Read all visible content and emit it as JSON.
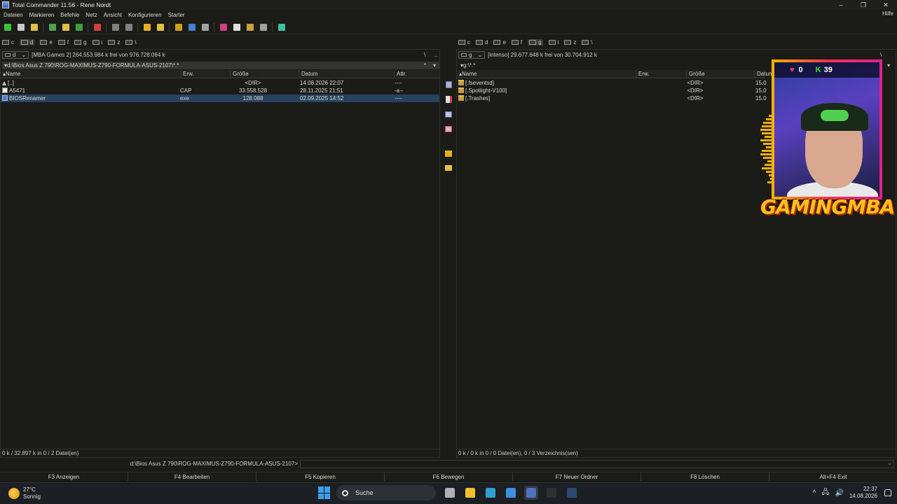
{
  "window": {
    "title": "Total Commander 11.56 - Rene Nordt",
    "controls": [
      "–",
      "❐",
      "✕"
    ]
  },
  "menu": {
    "items": [
      "Dateien",
      "Markieren",
      "Befehle",
      "Netz",
      "Ansicht",
      "Konfigurieren",
      "Starter"
    ],
    "help": "Hilfe"
  },
  "toolbar": {
    "buttons": [
      {
        "icon": "refresh-icon",
        "color": "#3cc03c"
      },
      {
        "icon": "brief-view-icon",
        "color": "#c8c8c8"
      },
      {
        "icon": "detailed-view-icon",
        "color": "#e0c040"
      },
      {
        "icon": "thumbnails-icon",
        "color": "#50a050"
      },
      {
        "icon": "tree-view-icon",
        "color": "#e0c040"
      },
      {
        "icon": "invert-selection-icon",
        "color": "#40a040"
      },
      {
        "icon": "compare-icon",
        "color": "#d04040"
      },
      {
        "icon": "back-icon",
        "color": "#808080"
      },
      {
        "icon": "forward-icon",
        "color": "#808080"
      },
      {
        "icon": "pack-icon",
        "color": "#e0b020"
      },
      {
        "icon": "unpack-icon",
        "color": "#e0c040"
      },
      {
        "icon": "find-icon",
        "color": "#c8a020"
      },
      {
        "icon": "multi-rename-icon",
        "color": "#4080d0"
      },
      {
        "icon": "sync-dirs-icon",
        "color": "#a0a0a0"
      },
      {
        "icon": "copy-names-icon",
        "color": "#d04080"
      },
      {
        "icon": "ftp-icon",
        "color": "#e0e0e0"
      },
      {
        "icon": "url-icon",
        "color": "#c8a040"
      },
      {
        "icon": "network-icon",
        "color": "#a0a0a0"
      },
      {
        "icon": "notepad-icon",
        "color": "#40c0a0"
      }
    ]
  },
  "left": {
    "drives": [
      {
        "label": "c"
      },
      {
        "label": "d",
        "active": true
      },
      {
        "label": "e"
      },
      {
        "label": "f"
      },
      {
        "label": "g"
      },
      {
        "label": "i"
      },
      {
        "label": "z"
      },
      {
        "label": "\\"
      }
    ],
    "drive_combo": "d",
    "drive_info": "[MBA Games 2]  264.553.984 k frei von 976.728.064 k",
    "root_btn": "\\",
    "up_btn": "..",
    "path": "d:\\Bios Asus Z 790\\ROG-MAXIMUS-Z790-FORMULA-ASUS-2107\\*.*",
    "path_star": "*",
    "columns": [
      "Name",
      "Erw.",
      "Größe",
      "Datum",
      "Attr."
    ],
    "files": [
      {
        "name": "[..]",
        "ext": "",
        "size": "<DIR>",
        "date": "14.08.2026 22:07",
        "attr": "----",
        "type": "up"
      },
      {
        "name": "A5471",
        "ext": "CAP",
        "size": "33.558.528",
        "date": "28.11.2025 21:51",
        "attr": "-a--",
        "type": "file"
      },
      {
        "name": "BIOSRenamer",
        "ext": "exe",
        "size": "128.088",
        "date": "02.09.2025 14:52",
        "attr": "----",
        "type": "exe",
        "selected": true
      }
    ],
    "status": "0 k / 32.897 k in 0 / 2 Datei(en)"
  },
  "right": {
    "drives": [
      {
        "label": "c"
      },
      {
        "label": "d"
      },
      {
        "label": "e"
      },
      {
        "label": "f"
      },
      {
        "label": "g",
        "active": true
      },
      {
        "label": "i"
      },
      {
        "label": "z"
      },
      {
        "label": "\\"
      }
    ],
    "drive_combo": "g",
    "drive_info": "[intenso]  29.677.648 k frei von 30.704.912 k",
    "root_btn": "\\",
    "path": "g:\\*.*",
    "columns": [
      "Name",
      "Erw.",
      "Größe",
      "Datum"
    ],
    "files": [
      {
        "name": "[.fseventsd]",
        "ext": "",
        "size": "<DIR>",
        "date": "15.0",
        "type": "folder"
      },
      {
        "name": "[.Spotlight-V100]",
        "ext": "",
        "size": "<DIR>",
        "date": "15.0",
        "type": "folder"
      },
      {
        "name": "[.Trashes]",
        "ext": "",
        "size": "<DIR>",
        "date": "15.0",
        "type": "folder"
      }
    ],
    "status": "0 k / 0 k in 0 / 0 Datei(en), 0 / 3 Verzeichnis(sen)"
  },
  "cmdline": {
    "label": "d:\\Bios Asus Z 790\\ROG-MAXIMUS-Z790-FORMULA-ASUS-2107>",
    "value": ""
  },
  "fkeys": [
    "F3 Anzeigen",
    "F4 Bearbeiten",
    "F5 Kopieren",
    "F6 Bewegen",
    "F7 Neuer Ordner",
    "F8 Löschen",
    "Alt+F4 Exit"
  ],
  "taskbar": {
    "weather": {
      "temp": "27°C",
      "desc": "Sonnig"
    },
    "search_placeholder": "Suche",
    "apps": [
      {
        "icon": "task-view-icon",
        "color": "#b0b0b0"
      },
      {
        "icon": "file-explorer-icon",
        "color": "#f0c030"
      },
      {
        "icon": "edge-icon",
        "color": "#30a0d0"
      },
      {
        "icon": "store-icon",
        "color": "#4090e0"
      },
      {
        "icon": "total-commander-icon",
        "color": "#5070c0",
        "active": true
      },
      {
        "icon": "obs-icon",
        "color": "#303030"
      },
      {
        "icon": "steam-icon",
        "color": "#2a4a70"
      }
    ],
    "tray": [
      "^",
      "🖧",
      "🔊"
    ],
    "time": "22:37",
    "date": "14.08.2026"
  },
  "overlay": {
    "hearts": "0",
    "kick": "39",
    "brand": "GAMINGMBA",
    "heart_symbol": "♥",
    "kick_symbol": "K"
  }
}
